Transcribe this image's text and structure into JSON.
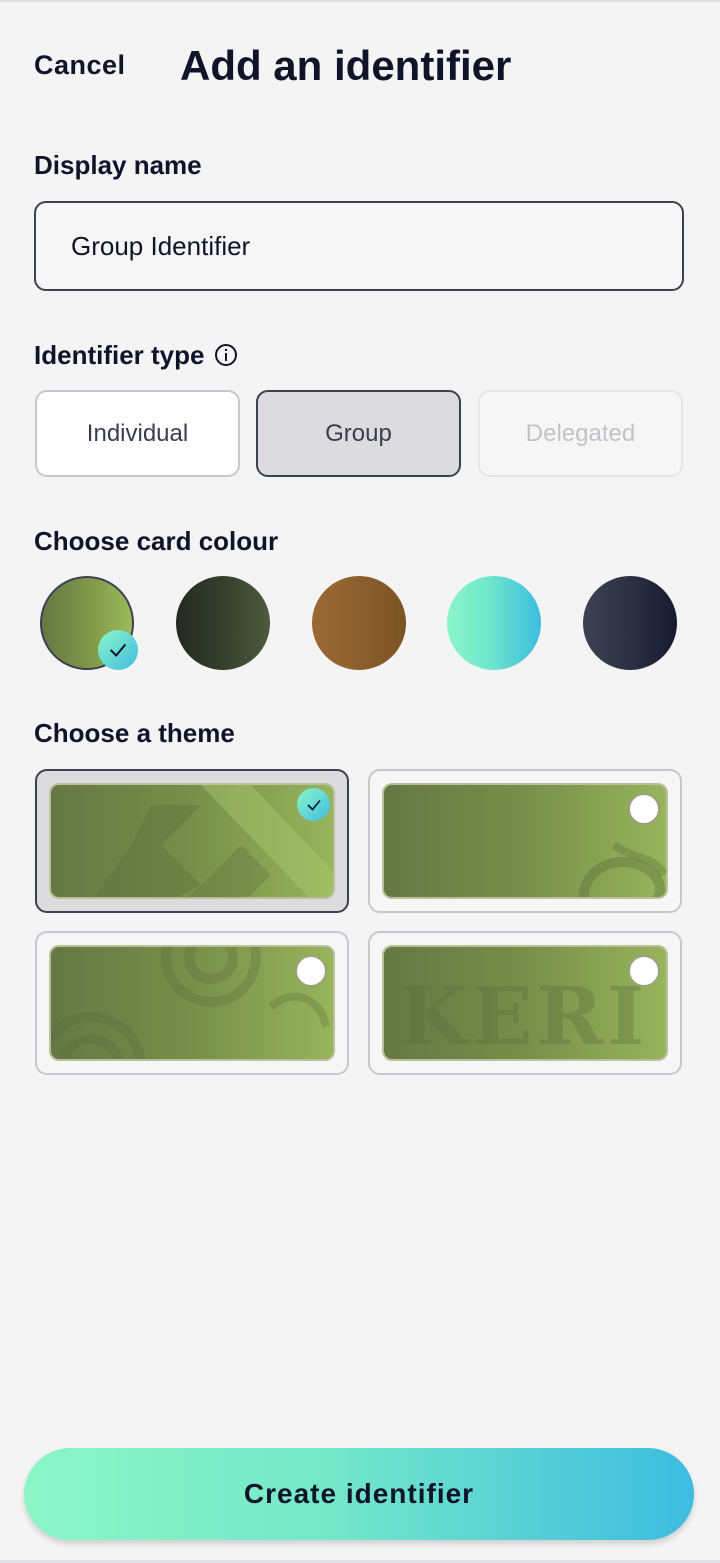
{
  "header": {
    "cancel_label": "Cancel",
    "title": "Add an identifier"
  },
  "display_name": {
    "label": "Display name",
    "value": "Group Identifier"
  },
  "identifier_type": {
    "label": "Identifier type",
    "info_icon": "info-icon",
    "options": [
      {
        "label": "Individual",
        "state": "default"
      },
      {
        "label": "Group",
        "state": "selected"
      },
      {
        "label": "Delegated",
        "state": "disabled"
      }
    ]
  },
  "card_colour": {
    "label": "Choose card colour",
    "swatches": [
      {
        "colors": [
          "#657844",
          "#9cba5a"
        ],
        "selected": true
      },
      {
        "colors": [
          "#24291f",
          "#4d5a3b"
        ],
        "selected": false
      },
      {
        "colors": [
          "#9a6a34",
          "#7b5423"
        ],
        "selected": false
      },
      {
        "colors": [
          "#8cf6c8",
          "#3ebce0"
        ],
        "selected": false
      },
      {
        "colors": [
          "#3d4352",
          "#181a30"
        ],
        "selected": false
      }
    ]
  },
  "theme": {
    "label": "Choose a theme",
    "options": [
      {
        "pattern": "geometric-k",
        "selected": true
      },
      {
        "pattern": "celtic-knot",
        "selected": false
      },
      {
        "pattern": "swirl",
        "selected": false
      },
      {
        "pattern": "keri-text",
        "text": "KERI",
        "selected": false
      }
    ]
  },
  "footer": {
    "create_label": "Create identifier"
  },
  "colors": {
    "accent_gradient": [
      "#8cf6c8",
      "#3ebce0"
    ],
    "text": "#10142a",
    "background": "#f4f4f5"
  }
}
